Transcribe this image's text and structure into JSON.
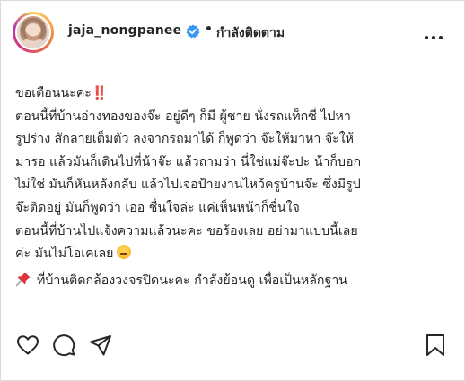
{
  "header": {
    "username": "jaja_nongpanee",
    "separator": "•",
    "follow_status": "กำลังติดตาม"
  },
  "caption": {
    "lines": [
      "ขอเตือนนะคะ",
      " ตอนนี้ที่บ้านอ่างทองของจ๊ะ อยู่ดีๆ ก็มี ผู้ชาย นั่งรถแท็กซี่ ไปหา",
      "รูปร่าง สักลายเต็มตัว ลงจากรถมาได้ ก็พูดว่า จ๊ะให้มาหา จ๊ะให้",
      "มารอ แล้วมันก็เดินไปที่น้าจ๊ะ แล้วถามว่า นี่ใช่แม่จ๊ะปะ น้าก็บอก",
      "ไม่ใช่ มันก็หันหลังกลับ แล้วไปเจอป้ายงานไหว้ครูบ้านจ๊ะ ซึ่งมีรูป",
      "จ๊ะติดอยู่ มันก็พูดว่า เออ ชื่นใจล่ะ แค่เห็นหน้าก็ชื่นใจ",
      "  ตอนนี้ที่บ้านไปแจ้งความแล้วนะคะ ขอร้องเลย อย่ามาแบบนี้เลย",
      "ค่ะ มันไม่โอเคเลย",
      "ที่บ้านติดกล้องวงจรปิดนะคะ กำลังย้อนดู เพื่อเป็นหลักฐาน"
    ],
    "exclamation": "‼️"
  },
  "icons": {
    "verified": "verified-badge-icon",
    "more": "more-options-icon",
    "like": "heart-icon",
    "comment": "comment-icon",
    "share": "share-icon",
    "save": "bookmark-icon",
    "pin": "pushpin-icon",
    "emoji": "tired-face-emoji"
  },
  "colors": {
    "text": "#262626",
    "verified": "#3897f0",
    "border": "#dbdbdb",
    "exclamation": "#e0262e"
  }
}
